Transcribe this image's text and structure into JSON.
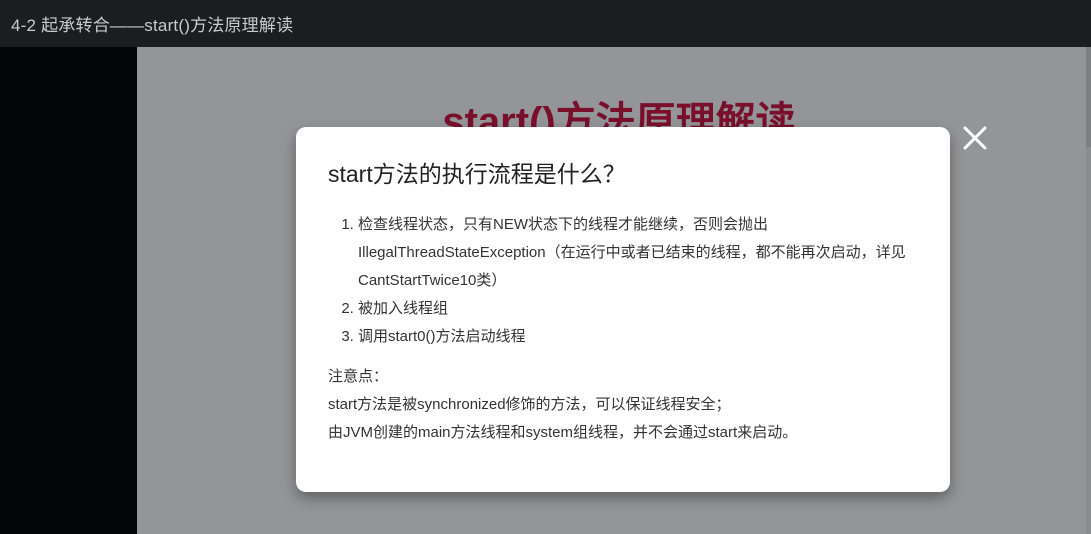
{
  "window": {
    "title": "4-2 起承转合——start()方法原理解读"
  },
  "slide": {
    "title": "start()方法原理解读"
  },
  "modal": {
    "heading": "start方法的执行流程是什么？",
    "steps": [
      "检查线程状态，只有NEW状态下的线程才能继续，否则会抛出IllegalThreadStateException（在运行中或者已结束的线程，都不能再次启动，详见CantStartTwice10类）",
      "被加入线程组",
      "调用start0()方法启动线程"
    ],
    "notes": [
      "注意点：",
      "start方法是被synchronized修饰的方法，可以保证线程安全；",
      "由JVM创建的main方法线程和system组线程，并不会通过start来启动。"
    ]
  },
  "icons": {
    "close": "close-icon"
  },
  "colors": {
    "topbar_bg": "#1b1d20",
    "overlay_gray": "#939598",
    "slide_title": "#7a0f2c",
    "modal_bg": "#ffffff"
  }
}
